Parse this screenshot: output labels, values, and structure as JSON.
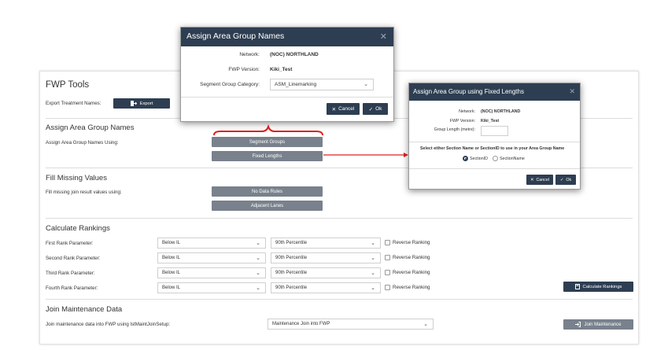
{
  "fwp_tools": {
    "title": "FWP Tools",
    "export_label": "Export Treatment Names:",
    "export_button": "Export",
    "assign_section": {
      "title": "Assign Area Group Names",
      "label": "Assign Area Group Names Using:",
      "segment_groups_button": "Segment Groups",
      "fixed_lengths_button": "Fixed Lengths"
    },
    "fill_section": {
      "title": "Fill Missing Values",
      "label": "Fill missing join result values using:",
      "no_data_rules_button": "No Data Rules",
      "adjacent_lanes_button": "Adjacent Lanes"
    },
    "rankings_section": {
      "title": "Calculate Rankings",
      "rows": [
        {
          "label": "First Rank Parameter:",
          "param": "Below IL",
          "percentile": "90th Percentile",
          "reverse": "Reverse Ranking"
        },
        {
          "label": "Second Rank Parameter:",
          "param": "Below IL",
          "percentile": "90th Percentile",
          "reverse": "Reverse Ranking"
        },
        {
          "label": "Third Rank Parameter:",
          "param": "Below IL",
          "percentile": "90th Percentile",
          "reverse": "Reverse Ranking"
        },
        {
          "label": "Fourth Rank Parameter:",
          "param": "Below IL",
          "percentile": "90th Percentile",
          "reverse": "Reverse Ranking"
        }
      ],
      "calculate_button": "Calculate Rankings"
    },
    "join_section": {
      "title": "Join Maintenance Data",
      "label": "Join maintenance data into FWP using lstMaintJoinSetup:",
      "select_value": "Maintenance Join into FWP",
      "join_button": "Join Maintenance"
    }
  },
  "modal_names": {
    "title": "Assign Area Group Names",
    "network_label": "Network:",
    "network_value": "(NOC) NORTHLAND",
    "version_label": "FWP Version:",
    "version_value": "Kiki_Test",
    "category_label": "Segment Group Category:",
    "category_value": "ASM_Linemarking",
    "cancel_button": "Cancel",
    "ok_button": "Ok"
  },
  "modal_fixed": {
    "title": "Assign Area Group using Fixed Lengths",
    "network_label": "Network:",
    "network_value": "(NOC) NORTHLAND",
    "version_label": "FWP Version:",
    "version_value": "Kiki_Test",
    "length_label": "Group Length (metre):",
    "length_value": "",
    "select_prompt": "Select either Section Name or SectionID to use in your Area Group Name",
    "option_section_id": "SectionID",
    "option_section_name": "SectionName",
    "cancel_button": "Cancel",
    "ok_button": "Ok"
  },
  "colors": {
    "header_navy": "#2e3e52",
    "button_gray": "#78818c",
    "annotation_red": "#e02020"
  }
}
